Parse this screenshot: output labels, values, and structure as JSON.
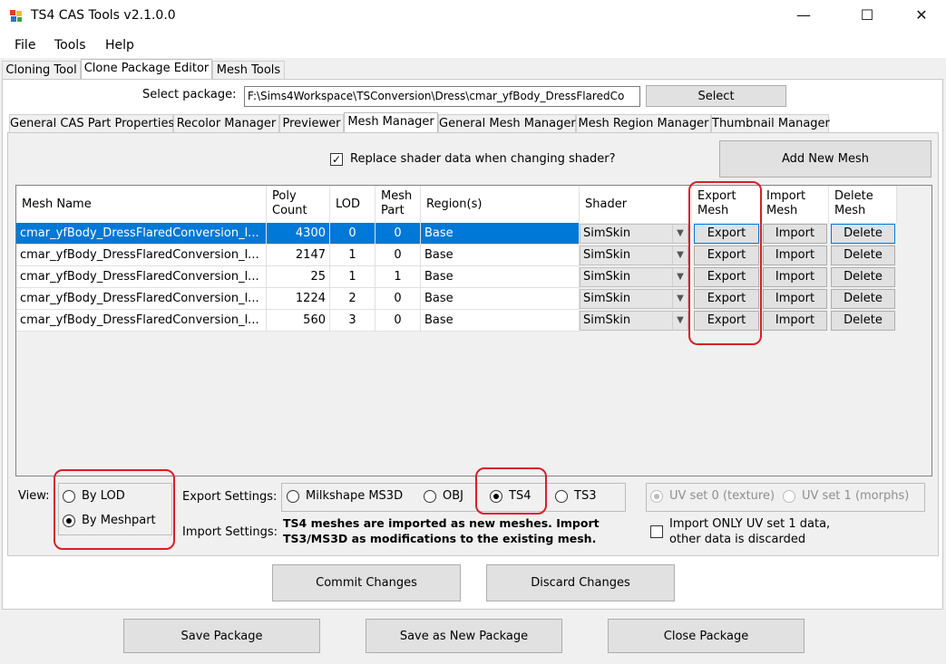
{
  "window": {
    "title": "TS4 CAS Tools v2.1.0.0",
    "minimize_glyph": "—",
    "maximize_glyph": "☐",
    "close_glyph": "✕"
  },
  "menu": [
    "File",
    "Tools",
    "Help"
  ],
  "main_tabs": [
    "Cloning Tool",
    "Clone Package Editor",
    "Mesh Tools"
  ],
  "select_package": {
    "label": "Select package:",
    "path": "F:\\Sims4Workspace\\TSConversion\\Dress\\cmar_yfBody_DressFlaredCo",
    "button": "Select"
  },
  "sub_tabs": [
    "General CAS Part Properties",
    "Recolor Manager",
    "Previewer",
    "Mesh Manager",
    "General Mesh Manager",
    "Mesh Region Manager",
    "Thumbnail Manager"
  ],
  "replace_shader": {
    "label": "Replace shader data when changing shader?",
    "checked": true
  },
  "add_mesh_button": "Add New Mesh",
  "grid": {
    "headers": {
      "mesh_name": "Mesh Name",
      "poly_count_1": "Poly",
      "poly_count_2": "Count",
      "lod": "LOD",
      "mesh_part_1": "Mesh",
      "mesh_part_2": "Part",
      "regions": "Region(s)",
      "shader": "Shader",
      "export_1": "Export",
      "export_2": "Mesh",
      "import_1": "Import",
      "import_2": "Mesh",
      "delete_1": "Delete",
      "delete_2": "Mesh"
    },
    "rows": [
      {
        "name": "cmar_yfBody_DressFlaredConversion_l...",
        "poly": "4300",
        "lod": "0",
        "part": "0",
        "region": "Base",
        "shader": "SimSkin",
        "export": "Export",
        "import": "Import",
        "delete": "Delete"
      },
      {
        "name": "cmar_yfBody_DressFlaredConversion_l...",
        "poly": "2147",
        "lod": "1",
        "part": "0",
        "region": "Base",
        "shader": "SimSkin",
        "export": "Export",
        "import": "Import",
        "delete": "Delete"
      },
      {
        "name": "cmar_yfBody_DressFlaredConversion_l...",
        "poly": "25",
        "lod": "1",
        "part": "1",
        "region": "Base",
        "shader": "SimSkin",
        "export": "Export",
        "import": "Import",
        "delete": "Delete"
      },
      {
        "name": "cmar_yfBody_DressFlaredConversion_l...",
        "poly": "1224",
        "lod": "2",
        "part": "0",
        "region": "Base",
        "shader": "SimSkin",
        "export": "Export",
        "import": "Import",
        "delete": "Delete"
      },
      {
        "name": "cmar_yfBody_DressFlaredConversion_l...",
        "poly": "560",
        "lod": "3",
        "part": "0",
        "region": "Base",
        "shader": "SimSkin",
        "export": "Export",
        "import": "Import",
        "delete": "Delete"
      }
    ]
  },
  "view": {
    "label": "View:",
    "by_lod": "By LOD",
    "by_meshpart": "By Meshpart",
    "selected": "By Meshpart"
  },
  "export_settings": {
    "label": "Export Settings:",
    "options": [
      "Milkshape MS3D",
      "OBJ",
      "TS4",
      "TS3"
    ],
    "selected": "TS4"
  },
  "import_settings": {
    "label": "Import Settings:",
    "note_1": "TS4 meshes are imported as new meshes. Import",
    "note_2": "TS3/MS3D as modifications to the existing mesh."
  },
  "uv": {
    "set0": "UV set 0 (texture)",
    "set1": "UV set 1 (morphs)",
    "selected": "UV set 0 (texture)"
  },
  "import_only_uv1": {
    "line1": "Import ONLY UV set 1 data,",
    "line2": "other data is discarded",
    "checked": false
  },
  "commit_button": "Commit Changes",
  "discard_button": "Discard Changes",
  "save_button": "Save Package",
  "save_new_button": "Save as New Package",
  "close_button": "Close Package",
  "colors": {
    "selection": "#0078d7",
    "highlight": "#d6202a"
  }
}
